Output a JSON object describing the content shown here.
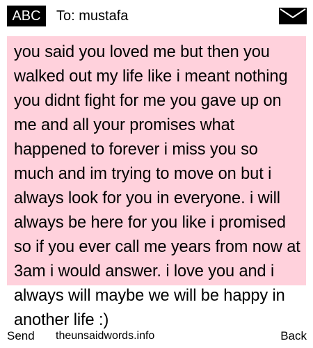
{
  "header": {
    "input_mode": "ABC",
    "recipient": "To: mustafa",
    "icon": "envelope-icon"
  },
  "message": {
    "text": "you said you loved me but then you walked out my life like i meant nothing you didnt fight for me you gave up on me and all your promises what happened to forever i miss you so much and im trying to move on but i always look for you in everyone. i will always be here for you like i promised so if you ever call me years from now at 3am i would answer. i love you and i always will maybe we will be happy in another life :)"
  },
  "softkeys": {
    "left": "Send",
    "right": "Back"
  },
  "watermark": "theunsaidwords.info",
  "colors": {
    "message_background": "#ffd1dc",
    "badge_background": "#000000",
    "badge_text": "#ffffff"
  }
}
